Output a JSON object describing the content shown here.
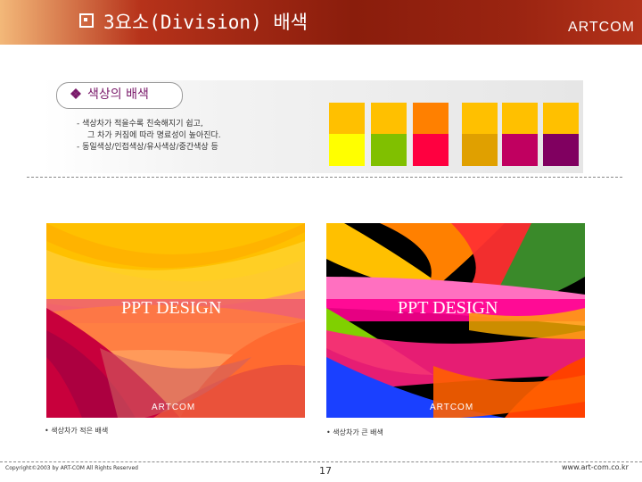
{
  "header": {
    "title": "3요소(Division) 배색",
    "brand": "ARTCOM",
    "bullet_icon": "checkbox-square-icon"
  },
  "section": {
    "title": "색상의 배색",
    "bullet_icon": "diamond-clover-icon",
    "description": [
      "- 색상차가 적을수록 친숙해지기 쉽고,",
      "그 차가 커짐에 따라 명료성이 높아진다.",
      "- 동일색상/인접색상/유사색상/중간색상 등"
    ],
    "swatches": [
      "#ffc000",
      "#ffc000",
      "#ff8000",
      "#ffc000",
      "#ffc000",
      "#ffc000",
      "#ffff00",
      "#80c000",
      "#ff0040",
      "#e0a000",
      "#c00060",
      "#800060"
    ]
  },
  "panels": [
    {
      "text": "PPT DESIGN",
      "brand": "ARTCOM",
      "caption": "• 색상차가 적은 배색"
    },
    {
      "text": "PPT DESIGN",
      "brand": "ARTCOM",
      "caption": "• 색상차가 큰 배색"
    }
  ],
  "footer": {
    "copyright": "Copyright©2003 by ART-COM All Rights Reserved",
    "page": "17",
    "url": "www.art-com.co.kr"
  }
}
